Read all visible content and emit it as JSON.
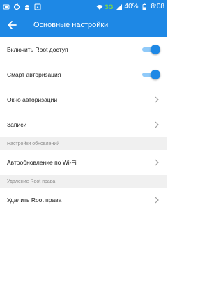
{
  "status_bar": {
    "network": "3G",
    "battery": "40%",
    "time": "8:08"
  },
  "app_bar": {
    "title": "Основные настройки",
    "back_icon": "arrow-left-icon"
  },
  "settings": {
    "enable_root": {
      "label": "Включить Root доступ",
      "enabled": true
    },
    "smart_auth": {
      "label": "Смарт авторизация",
      "enabled": true
    },
    "auth_window": {
      "label": "Окно авторизации"
    },
    "records": {
      "label": "Записи"
    }
  },
  "sections": {
    "updates_header": "Настройки обновлений",
    "wifi_update": {
      "label": "Автообновление по Wi-Fi"
    },
    "remove_header": "Удаление Root права",
    "remove_root": {
      "label": "Удалить Root права"
    }
  },
  "colors": {
    "primary": "#1e88e5",
    "toggle_track": "#90caf9",
    "section_bg": "#f0f0f0"
  }
}
